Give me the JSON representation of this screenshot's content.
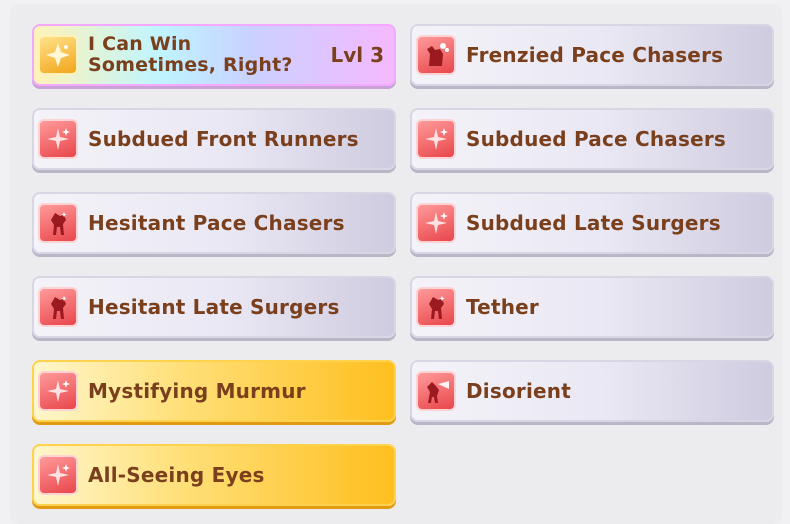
{
  "skills": [
    {
      "label": "I Can Win Sometimes, Right?",
      "level": "Lvl  3",
      "style": "rainbow",
      "icon": "golden-sparkle-icon"
    },
    {
      "label": "Frenzied Pace Chasers",
      "style": "normal",
      "icon": "frenzied-horse-icon"
    },
    {
      "label": "Subdued Front Runners",
      "style": "normal",
      "icon": "sparkle-icon"
    },
    {
      "label": "Subdued Pace Chasers",
      "style": "normal",
      "icon": "sparkle-icon"
    },
    {
      "label": "Hesitant Pace Chasers",
      "style": "normal",
      "icon": "horse-silhouette-icon"
    },
    {
      "label": "Subdued Late Surgers",
      "style": "normal",
      "icon": "sparkle-icon"
    },
    {
      "label": "Hesitant Late Surgers",
      "style": "normal",
      "icon": "horse-silhouette-icon"
    },
    {
      "label": "Tether",
      "style": "normal",
      "icon": "horse-silhouette-icon"
    },
    {
      "label": "Mystifying Murmur",
      "style": "gold",
      "icon": "sparkle-icon"
    },
    {
      "label": "Disorient",
      "style": "normal",
      "icon": "dizzy-horse-icon"
    },
    {
      "label": "All-Seeing Eyes",
      "style": "gold",
      "icon": "sparkle-icon"
    }
  ]
}
